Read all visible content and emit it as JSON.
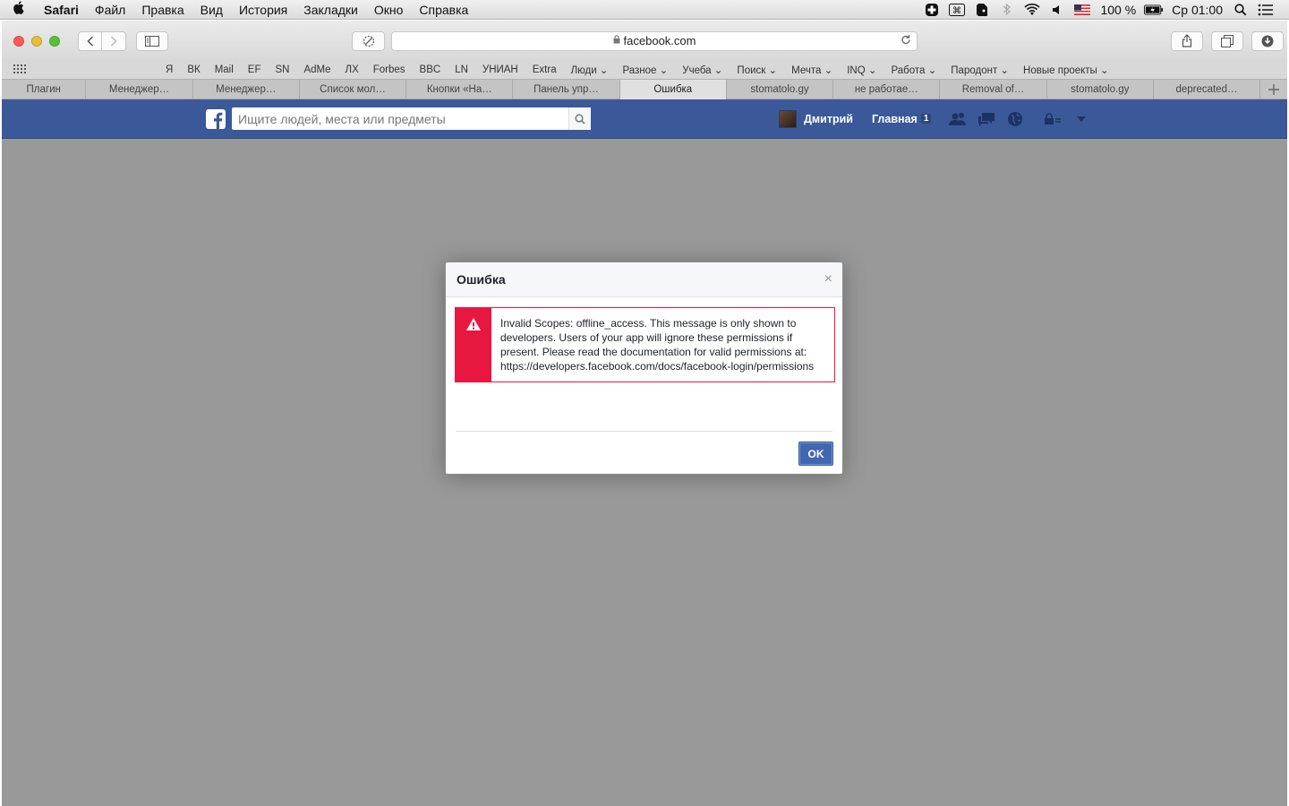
{
  "menubar": {
    "app": "Safari",
    "items": [
      "Файл",
      "Правка",
      "Вид",
      "История",
      "Закладки",
      "Окно",
      "Справка"
    ],
    "battery": "100 %",
    "clock": "Ср 01:00"
  },
  "browser": {
    "url": "facebook.com"
  },
  "bookmarks": [
    "Я",
    "ВК",
    "Mail",
    "EF",
    "SN",
    "AdMe",
    "ЛХ",
    "Forbes",
    "BBC",
    "LN",
    "УНИАН",
    "Extra",
    "Люди ⌄",
    "Разное ⌄",
    "Учеба ⌄",
    "Поиск ⌄",
    "Мечта ⌄",
    "INQ ⌄",
    "Работа ⌄",
    "Пародонт ⌄",
    "Новые проекты ⌄"
  ],
  "tabs": [
    "Плагин",
    "Менеджер…",
    "Менеджер…",
    "Список мол…",
    "Кнопки «На…",
    "Панель упр…",
    "Ошибка",
    "stomatolo.gy",
    "не работае…",
    "Removal of…",
    "stomatolo.gy",
    "deprecated…"
  ],
  "active_tab_index": 6,
  "facebook": {
    "search_placeholder": "Ищите людей, места или предметы",
    "user_name": "Дмитрий",
    "home_label": "Главная",
    "home_count": "1"
  },
  "dialog": {
    "title": "Ошибка",
    "close": "×",
    "error_lines": [
      "Invalid Scopes: offline_access. This message is only shown to",
      "developers. Users of your app will ignore these permissions if",
      "present. Please read the documentation for valid permissions at:",
      "https://developers.facebook.com/docs/facebook-login/permissions"
    ],
    "ok_label": "OK"
  },
  "colors": {
    "facebook_blue": "#3b5998",
    "error_red": "#e81740",
    "overlay_grey": "#999999"
  }
}
